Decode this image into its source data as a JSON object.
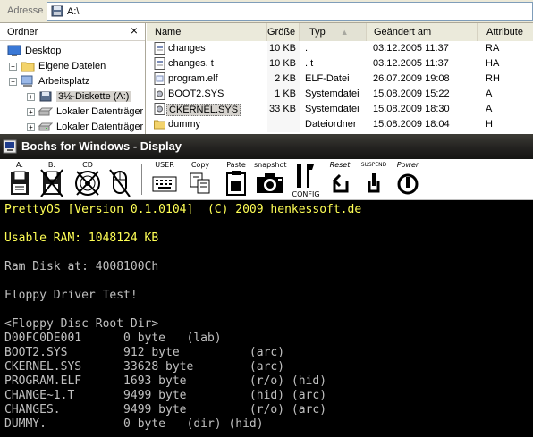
{
  "explorer": {
    "address": {
      "label": "Adresse",
      "value": "A:\\"
    },
    "folder_pane": {
      "title": "Ordner",
      "close": "×",
      "items": [
        {
          "label": "Desktop"
        },
        {
          "label": "Eigene Dateien"
        },
        {
          "label": "Arbeitsplatz"
        },
        {
          "label": "3½-Diskette (A:)"
        },
        {
          "label": "Lokaler Datenträger"
        },
        {
          "label": "Lokaler Datenträger"
        }
      ]
    },
    "columns": {
      "name": "Name",
      "size": "Größe",
      "type": "Typ",
      "modified": "Geändert am",
      "attributes": "Attribute"
    },
    "files": [
      {
        "name": "changes",
        "size": "10 KB",
        "type": ".",
        "modified": "03.12.2005 11:37",
        "attr": "RA",
        "icon": "text-file-icon"
      },
      {
        "name": "changes. t",
        "size": "10 KB",
        "type": ". t",
        "modified": "03.12.2005 11:37",
        "attr": "HA",
        "icon": "text-file-icon"
      },
      {
        "name": "program.elf",
        "size": "2 KB",
        "type": "ELF-Datei",
        "modified": "26.07.2009 19:08",
        "attr": "RH",
        "icon": "generic-file-icon"
      },
      {
        "name": "BOOT2.SYS",
        "size": "1 KB",
        "type": "Systemdatei",
        "modified": "15.08.2009 15:22",
        "attr": "A",
        "icon": "system-file-icon"
      },
      {
        "name": "CKERNEL.SYS",
        "size": "33 KB",
        "type": "Systemdatei",
        "modified": "15.08.2009 18:30",
        "attr": "A",
        "icon": "system-file-icon"
      },
      {
        "name": "dummy",
        "size": "",
        "type": "Dateiordner",
        "modified": "15.08.2009 18:04",
        "attr": "H",
        "icon": "folder-icon"
      }
    ]
  },
  "bochs": {
    "title": "Bochs for Windows - Display",
    "toolbar": [
      {
        "label": "A:",
        "icon": "floppy-a-icon"
      },
      {
        "label": "B:",
        "icon": "floppy-b-icon"
      },
      {
        "label": "CD",
        "icon": "cdrom-icon"
      },
      {
        "label": "",
        "icon": "mouse-icon"
      },
      {
        "label": "USER",
        "icon": "user-keyboard-icon"
      },
      {
        "label": "Copy",
        "icon": "copy-icon"
      },
      {
        "label": "Paste",
        "icon": "paste-icon"
      },
      {
        "label": "snapshot",
        "icon": "snapshot-icon"
      },
      {
        "label": "CONFIG",
        "icon": "config-icon"
      },
      {
        "label": "Reset",
        "icon": "reset-icon"
      },
      {
        "label": "SUSPEND",
        "icon": "suspend-icon"
      },
      {
        "label": "Power",
        "icon": "power-icon"
      }
    ],
    "console_lines": [
      {
        "text": "PrettyOS [Version 0.1.0104]  (C) 2009 henkessoft.de",
        "color": "yellow"
      },
      {
        "text": "",
        "color": "gray"
      },
      {
        "text": "Usable RAM: 1048124 KB",
        "color": "yellow"
      },
      {
        "text": "",
        "color": "gray"
      },
      {
        "text": "Ram Disk at: 4008100Ch",
        "color": "gray"
      },
      {
        "text": "",
        "color": "gray"
      },
      {
        "text": "Floppy Driver Test!",
        "color": "gray"
      },
      {
        "text": "",
        "color": "gray"
      },
      {
        "text": "<Floppy Disc Root Dir>",
        "color": "gray"
      },
      {
        "text": "D00FC0DE001      0 byte   (lab)",
        "color": "gray"
      },
      {
        "text": "BOOT2.SYS        912 byte          (arc)",
        "color": "gray"
      },
      {
        "text": "CKERNEL.SYS      33628 byte        (arc)",
        "color": "gray"
      },
      {
        "text": "PROGRAM.ELF      1693 byte         (r/o) (hid)",
        "color": "gray"
      },
      {
        "text": "CHANGE~1.T       9499 byte         (hid) (arc)",
        "color": "gray"
      },
      {
        "text": "CHANGES.         9499 byte         (r/o) (arc)",
        "color": "gray"
      },
      {
        "text": "DUMMY.           0 byte   (dir) (hid)",
        "color": "gray"
      }
    ]
  }
}
